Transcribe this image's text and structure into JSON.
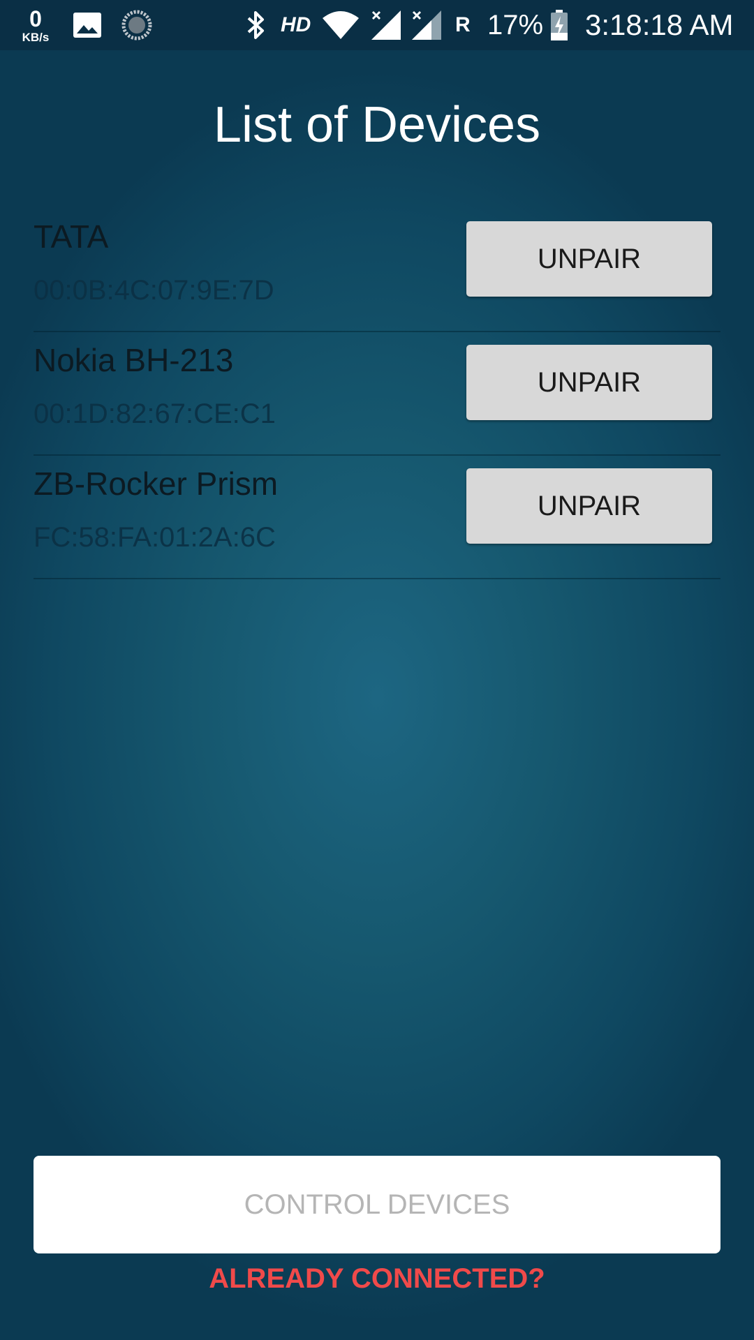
{
  "status_bar": {
    "net_speed_value": "0",
    "net_speed_unit": "KB/s",
    "hd_label": "HD",
    "roaming_label": "R",
    "battery_percent": "17%",
    "time": "3:18:18 AM",
    "icons": [
      "gallery-icon",
      "sync-icon",
      "bluetooth-icon",
      "wifi-icon",
      "signal-icon",
      "signal-icon",
      "battery-charging-icon"
    ]
  },
  "page": {
    "title": "List of Devices"
  },
  "devices": [
    {
      "name": "TATA",
      "mac": "00:0B:4C:07:9E:7D",
      "action_label": "UNPAIR"
    },
    {
      "name": "Nokia BH-213",
      "mac": "00:1D:82:67:CE:C1",
      "action_label": "UNPAIR"
    },
    {
      "name": "ZB-Rocker Prism",
      "mac": "FC:58:FA:01:2A:6C",
      "action_label": "UNPAIR"
    }
  ],
  "actions": {
    "control_devices_label": "CONTROL DEVICES",
    "already_connected_label": "ALREADY CONNECTED?"
  },
  "colors": {
    "accent_link": "#f04a4a",
    "background_dark": "#0b3a52",
    "background_light": "#1d6682",
    "button_gray": "#d8d8d8",
    "disabled_text": "#b5b5b5"
  }
}
